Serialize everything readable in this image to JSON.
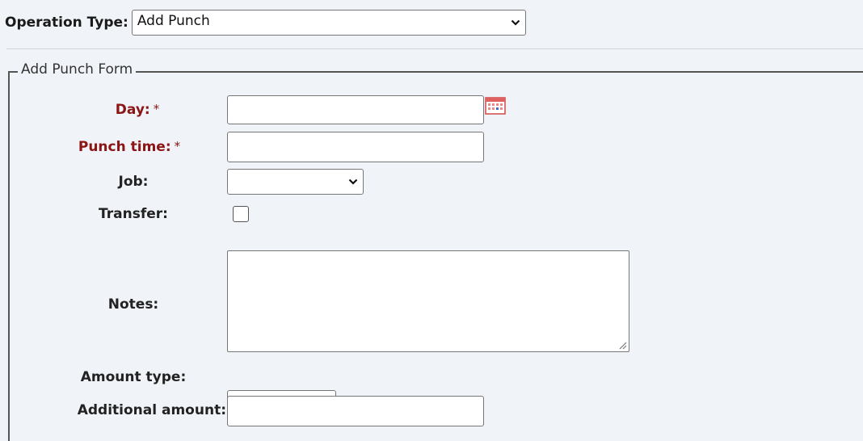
{
  "operation": {
    "label": "Operation Type:",
    "selected": "Add Punch"
  },
  "form": {
    "legend": "Add Punch Form",
    "required_marker": "*",
    "fields": {
      "day": {
        "label": "Day:",
        "value": ""
      },
      "punch_time": {
        "label": "Punch time:",
        "value": ""
      },
      "job": {
        "label": "Job:",
        "selected": ""
      },
      "transfer": {
        "label": "Transfer:",
        "checked": false
      },
      "notes": {
        "label": "Notes:",
        "value": ""
      },
      "amount_type": {
        "label": "Amount type:",
        "selected": ""
      },
      "additional_amount": {
        "label": "Additional amount:",
        "value": ""
      }
    }
  },
  "icons": {
    "calendar": "calendar-icon",
    "dropdown": "chevron-down-icon",
    "resize": "resize-grip-icon"
  },
  "colors": {
    "background": "#f0f3f7",
    "required_label": "#8b1414",
    "calendar_icon": "#e06060"
  }
}
